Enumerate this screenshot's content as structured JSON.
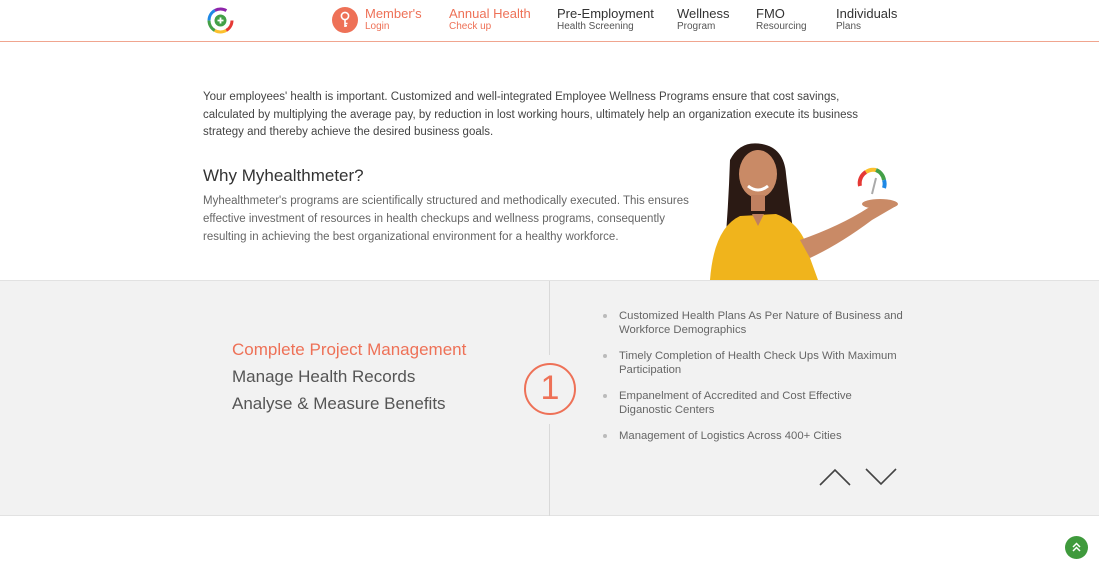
{
  "header": {
    "logo": "myhealthmeter-logo",
    "nav": [
      {
        "title": "Member's",
        "subtitle": "Login",
        "accent": true,
        "icon": "key-icon"
      },
      {
        "title": "Annual Health",
        "subtitle": "Check up",
        "accent": true
      },
      {
        "title": "Pre-Employment",
        "subtitle": "Health Screening",
        "accent": false
      },
      {
        "title": "Wellness",
        "subtitle": "Program",
        "accent": false
      },
      {
        "title": "FMO",
        "subtitle": "Resourcing",
        "accent": false
      },
      {
        "title": "Individuals",
        "subtitle": "Plans",
        "accent": false
      }
    ]
  },
  "intro": {
    "text": "Your employees' health is important. Customized and well-integrated Employee Wellness Programs ensure that cost savings, calculated by multiplying the average pay, by reduction in lost working hours, ultimately help an organization execute its business strategy and thereby achieve the desired business goals."
  },
  "why": {
    "title": "Why Myhealthmeter?",
    "text": "Myhealthmeter's programs are scientifically structured and methodically executed. This ensures effective investment of resources in health checkups and wellness programs, consequently resulting in achieving the best organizational environment for a healthy workforce."
  },
  "services": {
    "tabs": [
      "Complete Project Management",
      "Manage Health Records",
      "Analyse & Measure Benefits"
    ],
    "active_index": 0,
    "step_number": "1",
    "features": [
      "Customized Health Plans As Per Nature of Business and Workforce Demographics",
      "Timely Completion of Health Check Ups With Maximum Participation",
      "Empanelment of Accredited and Cost Effective Diganostic Centers",
      "Management of Logistics Across 400+ Cities"
    ]
  },
  "colors": {
    "accent": "#ee7157",
    "band": "#f2f2f2",
    "scroll_button": "#3f9a3c",
    "shirt": "#f0b41c"
  },
  "icons": {
    "arrow_up": "chevron-up-icon",
    "arrow_down": "chevron-down-icon",
    "scroll_top": "double-chevron-up-icon"
  }
}
